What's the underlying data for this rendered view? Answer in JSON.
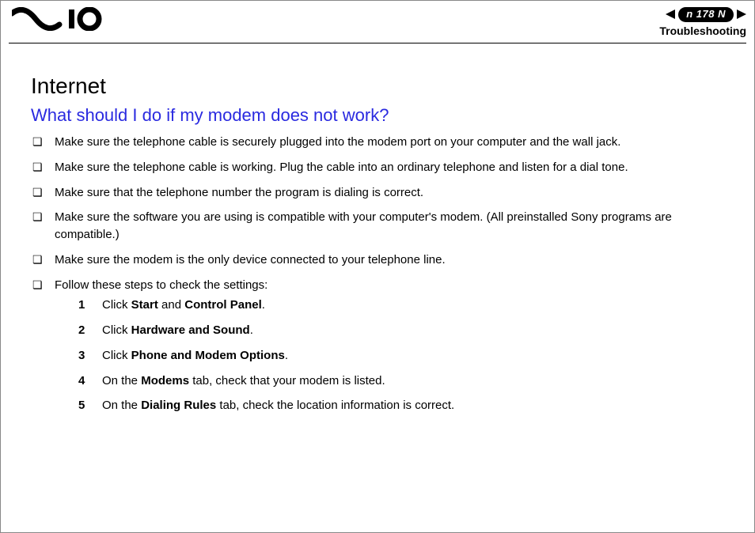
{
  "header": {
    "page_number": "178",
    "section": "Troubleshooting"
  },
  "content": {
    "title": "Internet",
    "subtitle": "What should I do if my modem does not work?",
    "bullets": [
      "Make sure the telephone cable is securely plugged into the modem port on your computer and the wall jack.",
      "Make sure the telephone cable is working. Plug the cable into an ordinary telephone and listen for a dial tone.",
      "Make sure that the telephone number the program is dialing is correct.",
      "Make sure the software you are using is compatible with your computer's modem. (All preinstalled Sony programs are compatible.)",
      "Make sure the modem is the only device connected to your telephone line.",
      "Follow these steps to check the settings:"
    ],
    "steps": [
      {
        "pre": "Click ",
        "bold": "Start",
        "mid": " and ",
        "bold2": "Control Panel",
        "post": "."
      },
      {
        "pre": "Click ",
        "bold": "Hardware and Sound",
        "mid": "",
        "bold2": "",
        "post": "."
      },
      {
        "pre": "Click ",
        "bold": "Phone and Modem Options",
        "mid": "",
        "bold2": "",
        "post": "."
      },
      {
        "pre": "On the ",
        "bold": "Modems",
        "mid": " tab, check that your modem is listed.",
        "bold2": "",
        "post": ""
      },
      {
        "pre": "On the ",
        "bold": "Dialing Rules",
        "mid": " tab, check the location information is correct.",
        "bold2": "",
        "post": ""
      }
    ]
  }
}
